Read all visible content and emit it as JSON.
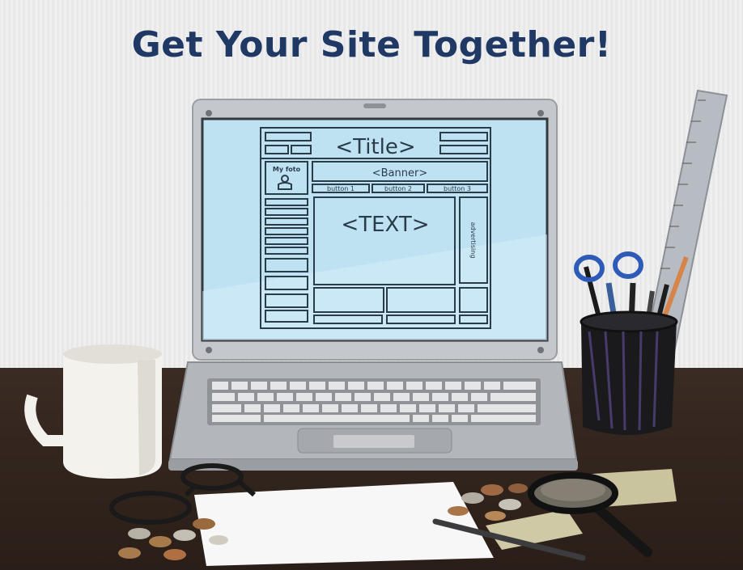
{
  "headline": "Get Your Site Together!",
  "wireframe": {
    "title": "<Title>",
    "banner": "<Banner>",
    "photo_label": "My foto",
    "buttons": [
      "button 1",
      "button 2",
      "button 3"
    ],
    "main_text": "<TEXT>",
    "sidebar_label": "advertising"
  },
  "colors": {
    "headline": "#1f3864",
    "screen": "#bfe2f3",
    "desk": "#2f221b",
    "laptop": "#b9bcc0"
  }
}
